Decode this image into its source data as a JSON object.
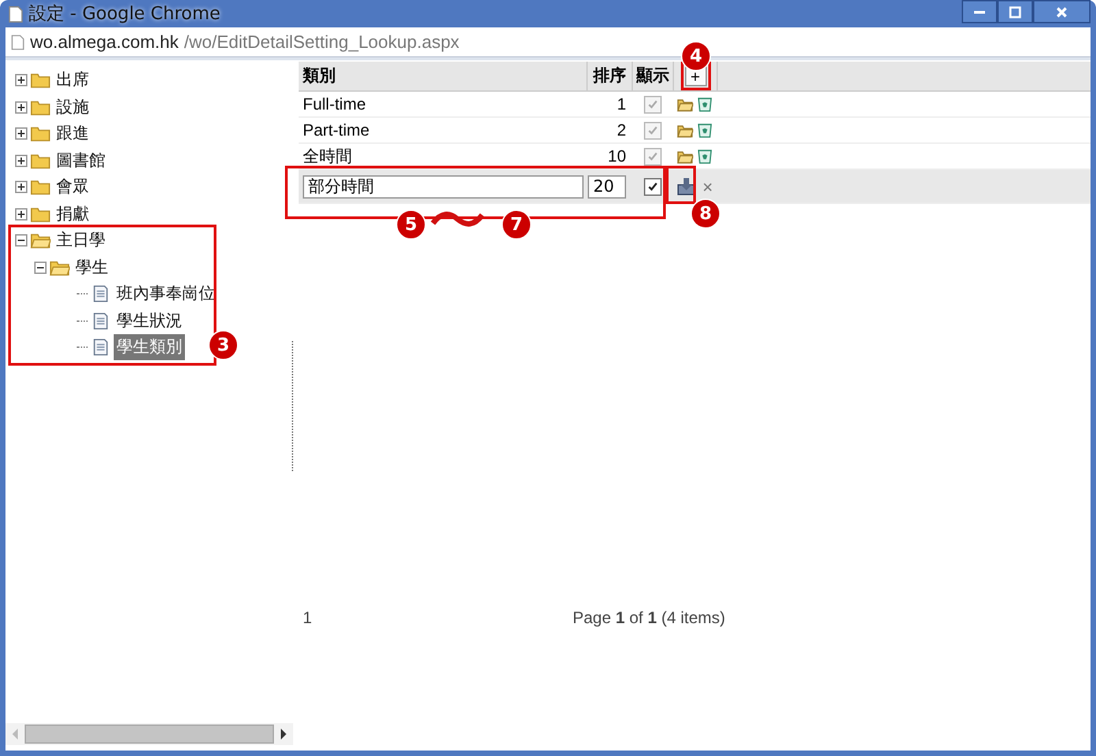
{
  "window": {
    "title": "設定 - Google Chrome"
  },
  "address": {
    "host": "wo.almega.com.hk",
    "path": "/wo/EditDetailSetting_Lookup.aspx"
  },
  "tree": [
    {
      "label": "出席",
      "kind": "folder",
      "expanded": false,
      "selected": false
    },
    {
      "label": "設施",
      "kind": "folder",
      "expanded": false,
      "selected": false
    },
    {
      "label": "跟進",
      "kind": "folder",
      "expanded": false,
      "selected": false
    },
    {
      "label": "圖書館",
      "kind": "folder",
      "expanded": false,
      "selected": false
    },
    {
      "label": "會眾",
      "kind": "folder",
      "expanded": false,
      "selected": false
    },
    {
      "label": "捐獻",
      "kind": "folder",
      "expanded": false,
      "selected": false
    },
    {
      "label": "主日學",
      "kind": "folder",
      "expanded": true,
      "selected": false,
      "children": [
        {
          "label": "學生",
          "kind": "folder",
          "expanded": true,
          "selected": false,
          "children": [
            {
              "label": "班內事奉崗位",
              "kind": "page",
              "selected": false
            },
            {
              "label": "學生狀況",
              "kind": "page",
              "selected": false
            },
            {
              "label": "學生類別",
              "kind": "page",
              "selected": true
            }
          ]
        }
      ]
    }
  ],
  "grid": {
    "columns": [
      "類別",
      "排序",
      "顯示"
    ],
    "add_button": "+",
    "rows": [
      {
        "name": "Full-time",
        "order": "1",
        "visible": true
      },
      {
        "name": "Part-time",
        "order": "2",
        "visible": true
      },
      {
        "name": "全時間",
        "order": "10",
        "visible": true
      }
    ],
    "edit_row": {
      "name": "部分時間",
      "order": "20",
      "visible": true,
      "cancel": "×"
    }
  },
  "pager": {
    "page": "1",
    "summary": "Page **1** of **1** (4 items)"
  },
  "annotations": [
    "3",
    "4",
    "5",
    "7",
    "8"
  ]
}
